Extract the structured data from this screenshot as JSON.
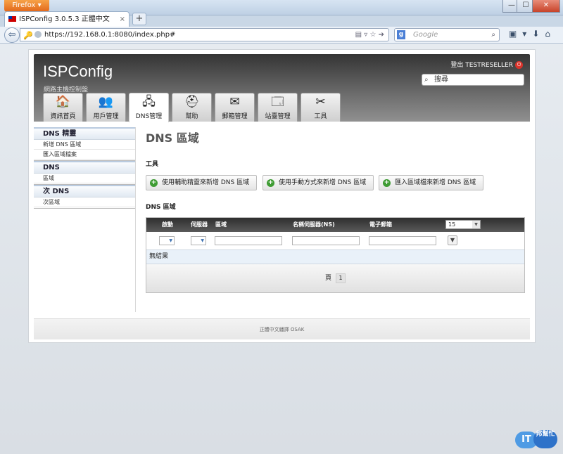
{
  "browser": {
    "menu_button": "Firefox",
    "tab_title": "ISPConfig 3.0.5.3 正體中文",
    "tab_close": "×",
    "new_tab": "+",
    "url": "https://192.168.0.1:8080/index.php#",
    "search_engine_letter": "g",
    "search_placeholder": "Google",
    "window_controls": [
      "—",
      "☐",
      "✕"
    ]
  },
  "header": {
    "logo": "ISPConfig",
    "subtitle": "網路主機控制盤",
    "logout_label": "登出 TESTRESELLER",
    "search_value": "搜尋"
  },
  "tabs": [
    {
      "label": "資訊首頁",
      "icon": "home-icon",
      "glyph": "🏠"
    },
    {
      "label": "用戶管理",
      "icon": "users-icon",
      "glyph": "👥"
    },
    {
      "label": "DNS管理",
      "icon": "dns-icon",
      "glyph": "🖧"
    },
    {
      "label": "幫助",
      "icon": "help-icon",
      "glyph": "⛑"
    },
    {
      "label": "郵箱管理",
      "icon": "mail-icon",
      "glyph": "✉"
    },
    {
      "label": "站臺管理",
      "icon": "sites-icon",
      "glyph": "🗔"
    },
    {
      "label": "工具",
      "icon": "tools-icon",
      "glyph": "✂"
    }
  ],
  "sidebar": {
    "sections": [
      {
        "title": "DNS 精靈",
        "items": [
          "新增 DNS 區域",
          "匯入區域檔案"
        ]
      },
      {
        "title": "DNS",
        "items": [
          "區域"
        ]
      },
      {
        "title": "次 DNS",
        "items": [
          "次區域"
        ]
      }
    ]
  },
  "main": {
    "title": "DNS 區域",
    "tools_heading": "工具",
    "buttons": [
      "使用輔助精靈來新增 DNS 區域",
      "使用手動方式來新增 DNS 區域",
      "匯入區域檔來新增 DNS 區域"
    ],
    "list_heading": "DNS 區域",
    "columns": [
      "啟動",
      "伺服器",
      "區域",
      "名稱伺服器(NS)",
      "電子郵箱"
    ],
    "page_size": "15",
    "no_results": "無結果",
    "pager_label": "頁",
    "current_page": "1"
  },
  "footer": {
    "text": "正體中文繙譯 OSAK"
  },
  "watermark": {
    "it": "IT",
    "bang": "邦幫忙"
  }
}
